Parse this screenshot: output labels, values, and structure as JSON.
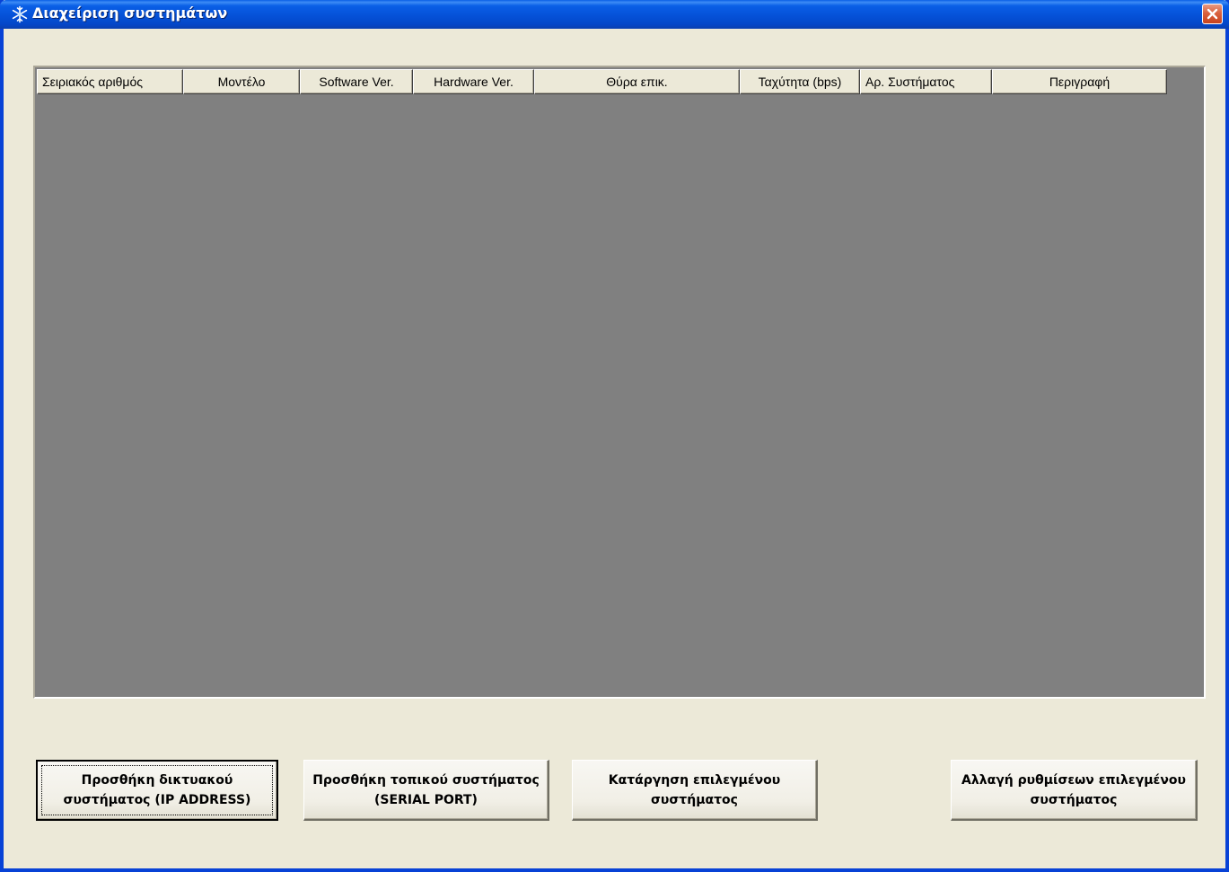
{
  "window": {
    "title": "Διαχείριση συστημάτων",
    "icon": "snowflake-icon",
    "close_icon": "close-icon"
  },
  "list": {
    "columns": [
      "Σειριακός αριθμός",
      "Μοντέλο",
      "Software Ver.",
      "Hardware Ver.",
      "Θύρα επικ.",
      "Ταχύτητα (bps)",
      "Αρ. Συστήματος",
      "Περιγραφή"
    ],
    "rows": []
  },
  "buttons": {
    "add_network": "Προσθήκη δικτυακού συστήματος (IP ADDRESS)",
    "add_local": "Προσθήκη τοπικού συστήματος (SERIAL PORT)",
    "remove_selected": "Κατάργηση επιλεγμένου συστήματος",
    "change_settings": "Αλλαγή ρυθμίσεων επιλεγμένου συστήματος"
  },
  "colors": {
    "titlebar": "#0551d8",
    "list_background": "#808080",
    "dialog_background": "#ece9d8",
    "close_button": "#d9623f"
  }
}
